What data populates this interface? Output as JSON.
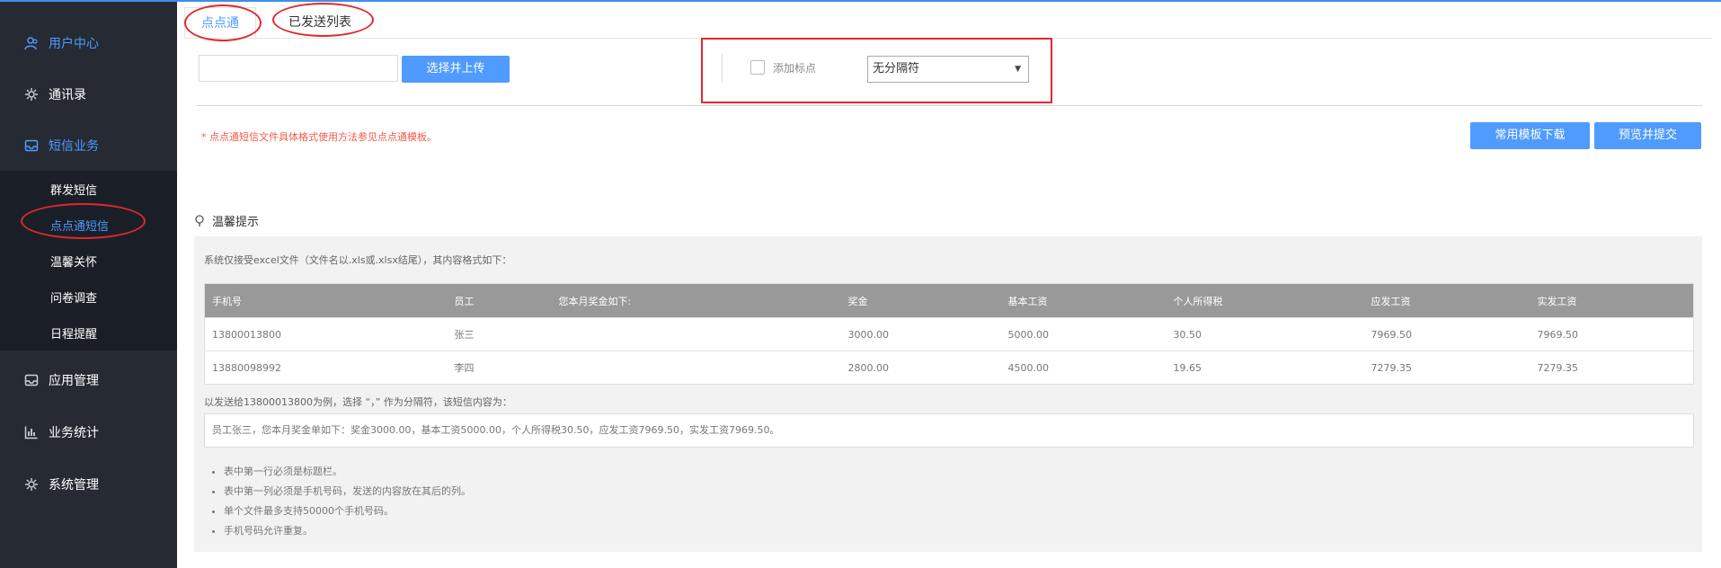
{
  "sidebar": {
    "user_center": "用户中心",
    "contacts": "通讯录",
    "sms_business": "短信业务",
    "sub": [
      "群发短信",
      "点点通短信",
      "温馨关怀",
      "问卷调查",
      "日程提醒"
    ],
    "app_management": "应用管理",
    "business_stats": "业务统计",
    "system_management": "系统管理"
  },
  "tabs": {
    "active": "点点通",
    "sent_list": "已发送列表"
  },
  "upload": {
    "file_value": "",
    "upload_button": "选择并上传"
  },
  "options": {
    "add_punct_label": "添加标点",
    "add_punct_checked": false,
    "separator_selected": "无分隔符"
  },
  "note": "* 点点通短信文件具体格式使用方法参见点点通模板。",
  "actions": {
    "download_template": "常用模板下载",
    "preview_submit": "预览并提交"
  },
  "tips": {
    "title": "温馨提示",
    "intro": "系统仅接受excel文件（文件名以.xls或.xlsx结尾），其内容格式如下：",
    "table": {
      "headers": [
        "手机号",
        "员工",
        "您本月奖金如下:",
        "奖金",
        "基本工资",
        "个人所得税",
        "应发工资",
        "实发工资"
      ],
      "rows": [
        [
          "13800013800",
          "张三",
          "",
          "3000.00",
          "5000.00",
          "30.50",
          "7969.50",
          "7969.50"
        ],
        [
          "13880098992",
          "李四",
          "",
          "2800.00",
          "4500.00",
          "19.65",
          "7279.35",
          "7279.35"
        ]
      ]
    },
    "example_label": "以发送给13800013800为例，选择 “，” 作为分隔符，该短信内容为：",
    "example_text": "员工张三，您本月奖金单如下：奖金3000.00，基本工资5000.00，个人所得税30.50，应发工资7969.50，实发工资7969.50。",
    "bullets": [
      "表中第一行必须是标题栏。",
      "表中第一列必须是手机号码，发送的内容放在其后的列。",
      "单个文件最多支持50000个手机号码。",
      "手机号码允许重复。"
    ]
  },
  "colors": {
    "accent": "#4f9bff",
    "sidebar_bg": "#252a33",
    "annotation": "#e0282d",
    "note": "#f15b4a"
  }
}
